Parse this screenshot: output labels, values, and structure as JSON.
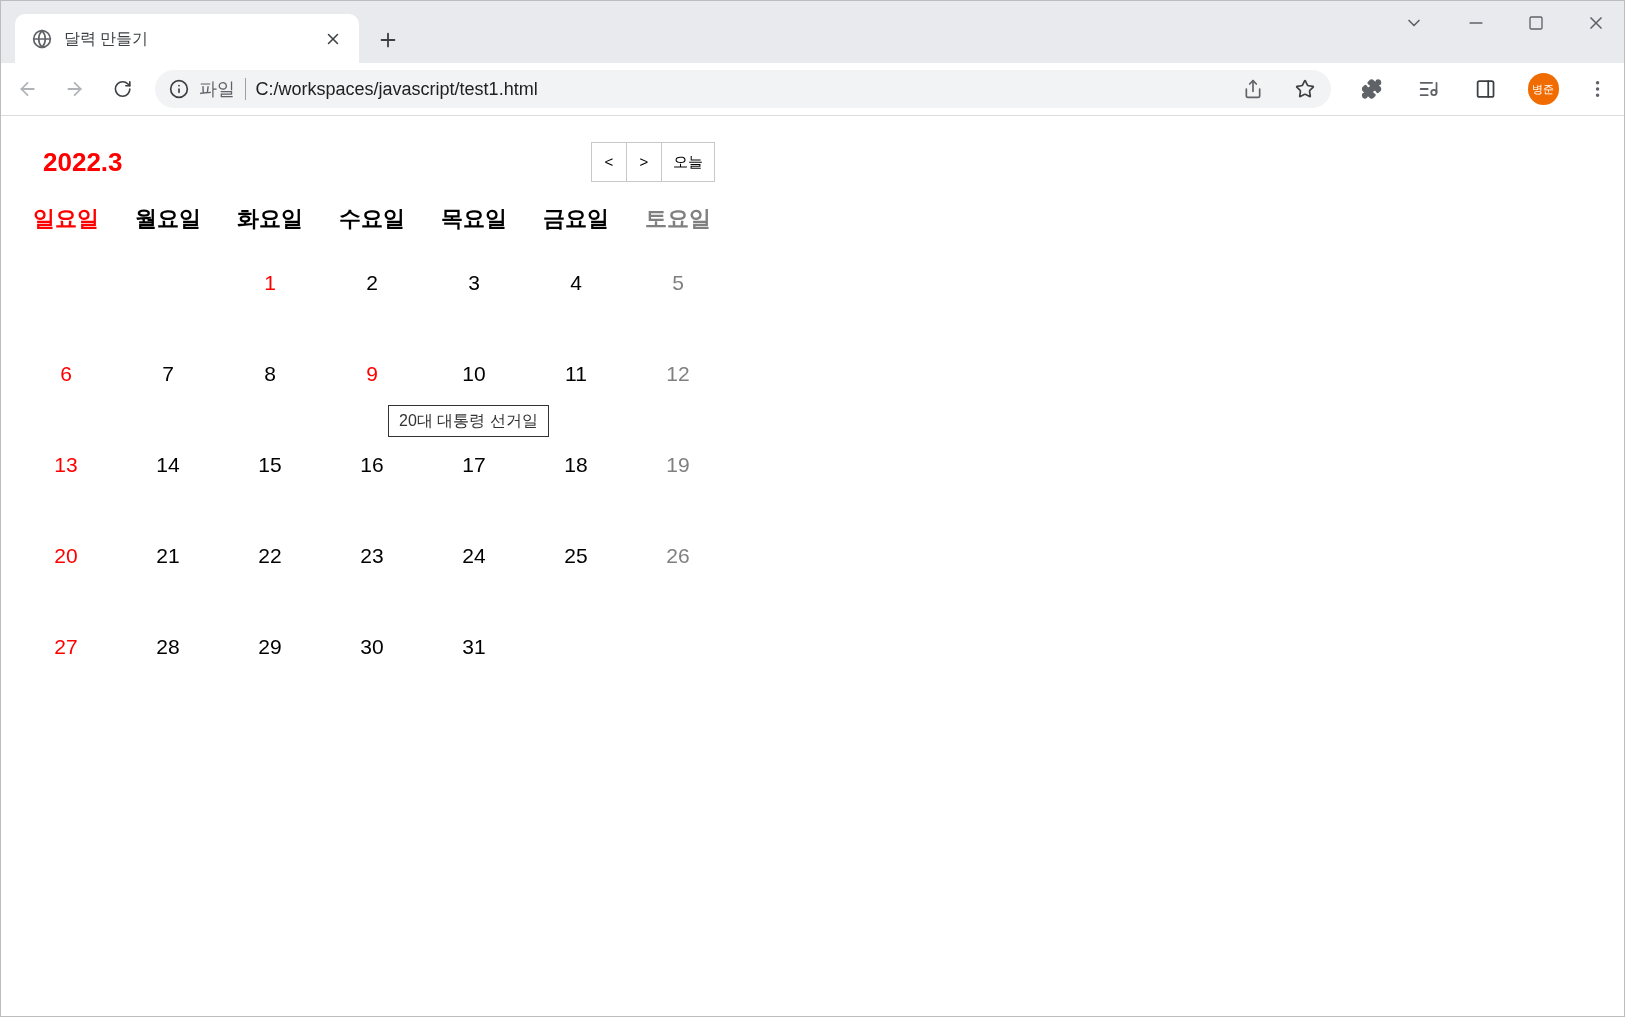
{
  "browser": {
    "tab_title": "달력 만들기",
    "address_label": "파일",
    "url": "C:/workspaces/javascript/test1.html",
    "profile": "병준"
  },
  "calendar": {
    "title": "2022.3",
    "nav_buttons": [
      "<",
      ">",
      "오늘"
    ],
    "weekdays": [
      {
        "label": "일요일",
        "kind": "sunday"
      },
      {
        "label": "월요일",
        "kind": "weekday"
      },
      {
        "label": "화요일",
        "kind": "weekday"
      },
      {
        "label": "수요일",
        "kind": "weekday"
      },
      {
        "label": "목요일",
        "kind": "weekday"
      },
      {
        "label": "금요일",
        "kind": "weekday"
      },
      {
        "label": "토요일",
        "kind": "saturday"
      }
    ],
    "weeks": [
      [
        {
          "kind": "empty"
        },
        {
          "kind": "empty"
        },
        {
          "day": "1",
          "kind": "holiday"
        },
        {
          "day": "2",
          "kind": "weekday"
        },
        {
          "day": "3",
          "kind": "weekday"
        },
        {
          "day": "4",
          "kind": "weekday"
        },
        {
          "day": "5",
          "kind": "saturday"
        }
      ],
      [
        {
          "day": "6",
          "kind": "holiday"
        },
        {
          "day": "7",
          "kind": "weekday"
        },
        {
          "day": "8",
          "kind": "weekday"
        },
        {
          "day": "9",
          "kind": "holiday",
          "tooltip": "20대 대통령 선거일"
        },
        {
          "day": "10",
          "kind": "weekday"
        },
        {
          "day": "11",
          "kind": "weekday"
        },
        {
          "day": "12",
          "kind": "saturday"
        }
      ],
      [
        {
          "day": "13",
          "kind": "holiday"
        },
        {
          "day": "14",
          "kind": "weekday"
        },
        {
          "day": "15",
          "kind": "weekday"
        },
        {
          "day": "16",
          "kind": "weekday"
        },
        {
          "day": "17",
          "kind": "weekday"
        },
        {
          "day": "18",
          "kind": "weekday"
        },
        {
          "day": "19",
          "kind": "saturday"
        }
      ],
      [
        {
          "day": "20",
          "kind": "holiday"
        },
        {
          "day": "21",
          "kind": "weekday"
        },
        {
          "day": "22",
          "kind": "weekday"
        },
        {
          "day": "23",
          "kind": "weekday"
        },
        {
          "day": "24",
          "kind": "weekday"
        },
        {
          "day": "25",
          "kind": "weekday"
        },
        {
          "day": "26",
          "kind": "saturday"
        }
      ],
      [
        {
          "day": "27",
          "kind": "holiday"
        },
        {
          "day": "28",
          "kind": "weekday"
        },
        {
          "day": "29",
          "kind": "weekday"
        },
        {
          "day": "30",
          "kind": "weekday"
        },
        {
          "day": "31",
          "kind": "weekday"
        },
        {
          "kind": "empty"
        },
        {
          "kind": "empty"
        }
      ]
    ]
  }
}
